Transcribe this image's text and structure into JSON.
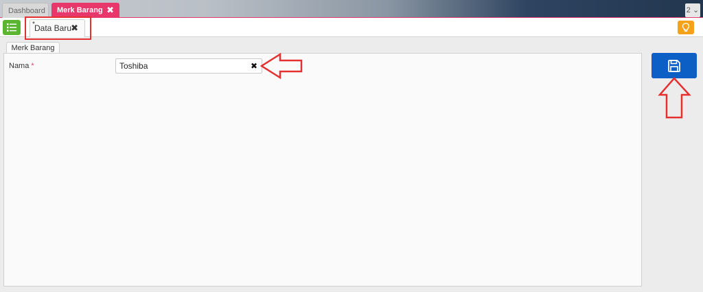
{
  "top_tabs": [
    {
      "label": "Dashboard"
    },
    {
      "label": "Merk Barang",
      "close": "✖"
    }
  ],
  "tab_count": "2 ⌄",
  "sub_tab": {
    "star": "*",
    "label": "Data Baru",
    "close": "✖"
  },
  "panel": {
    "tab_label": "Merk Barang"
  },
  "form": {
    "nama_label": "Nama",
    "required_mark": "*",
    "nama_value": "Toshiba",
    "clear": "✖"
  },
  "colors": {
    "accent": "#e8386b",
    "save": "#0c5fc5",
    "list": "#5cb531",
    "bulb": "#f5a21b",
    "annotation": "#e53030"
  },
  "icons": [
    "list-icon",
    "lightbulb-icon",
    "floppy-disk-icon",
    "close-icon",
    "clear-icon"
  ]
}
